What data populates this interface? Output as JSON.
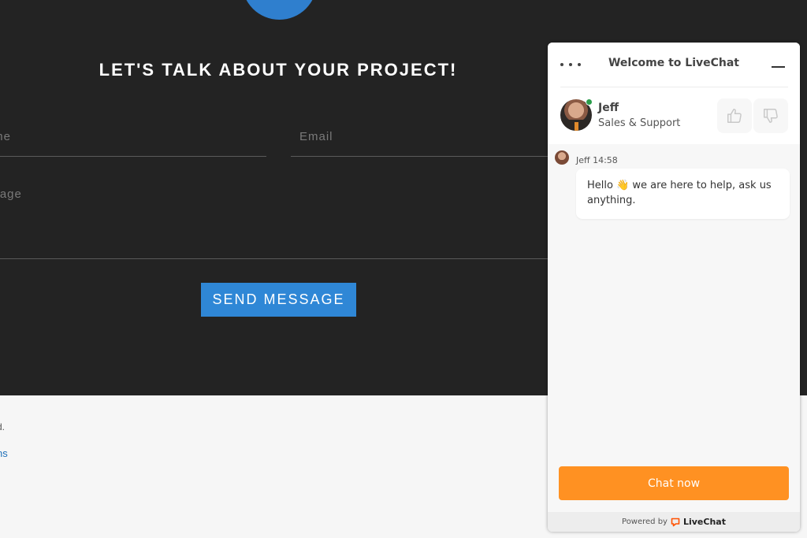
{
  "contact": {
    "title": "LET'S TALK ABOUT YOUR PROJECT!",
    "name_placeholder": "Name",
    "email_placeholder": "Email",
    "message_placeholder": "Message",
    "send_label": "SEND MESSAGE",
    "accent_color": "#2f87d6"
  },
  "footer": {
    "text": "d.",
    "link": "ns"
  },
  "chat": {
    "title": "Welcome to LiveChat",
    "agent": {
      "name": "Jeff",
      "role": "Sales & Support",
      "status": "online"
    },
    "rating_icons": [
      "thumbs-up-icon",
      "thumbs-down-icon"
    ],
    "messages": [
      {
        "author": "Jeff",
        "time": "14:58",
        "meta": "Jeff 14:58",
        "text": "Hello 👋 we are here to help, ask us anything."
      }
    ],
    "chat_now_label": "Chat now",
    "powered_by": "Powered by",
    "brand": "LiveChat",
    "accent_color": "#ff9122"
  }
}
